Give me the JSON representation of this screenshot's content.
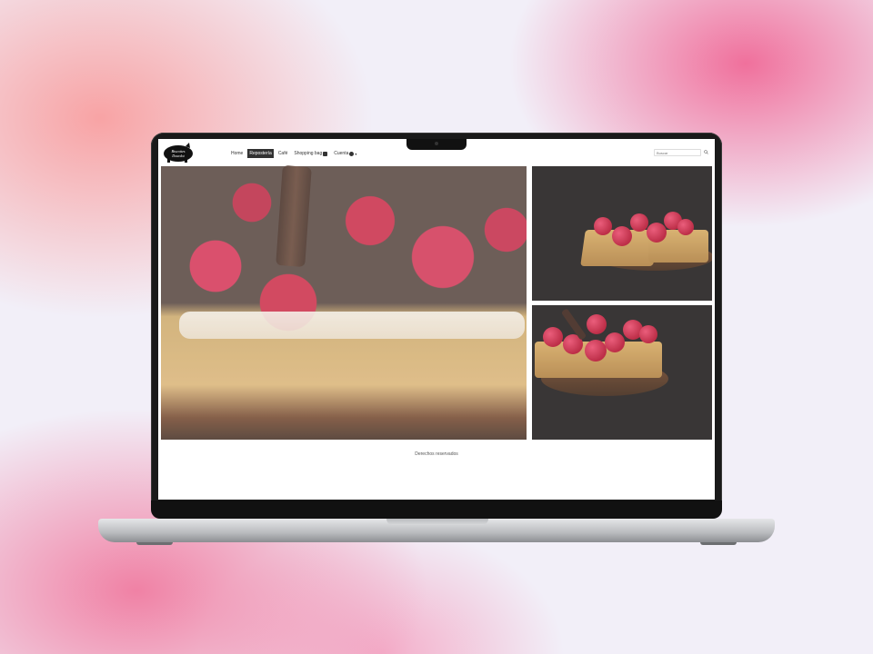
{
  "site": {
    "logo_text": "Biscottes\nDourdot"
  },
  "nav": {
    "items": [
      {
        "label": "Home",
        "active": false
      },
      {
        "label": "Repostería",
        "active": true
      },
      {
        "label": "Café",
        "active": false
      },
      {
        "label": "Shopping bag",
        "active": false,
        "icon": "bag-icon"
      },
      {
        "label": "Cuenta",
        "active": false,
        "icon": "user-icon",
        "dropdown": true
      }
    ]
  },
  "search": {
    "placeholder": "Buscar"
  },
  "gallery": {
    "caption": "Derechos reservados"
  },
  "colors": {
    "accent": "#333333",
    "raspberry": "#c8233f",
    "tart": "#d4a85f"
  }
}
